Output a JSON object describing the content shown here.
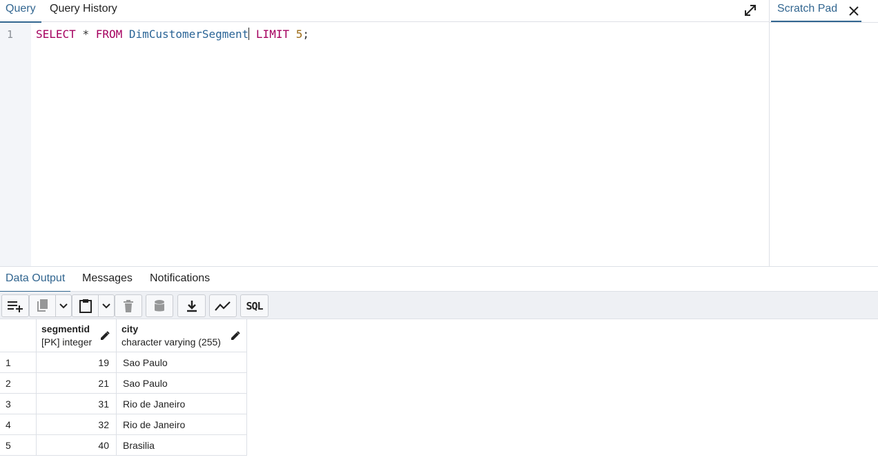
{
  "tabs": {
    "query": "Query",
    "query_history": "Query History"
  },
  "scratch_pad": {
    "title": "Scratch Pad"
  },
  "editor": {
    "line_number": "1",
    "tokens": {
      "select": "SELECT",
      "star": "*",
      "from": "FROM",
      "table": "DimCustomerSegment",
      "limit": "LIMIT",
      "limit_value": "5",
      "semicolon": ";"
    }
  },
  "output_tabs": {
    "data_output": "Data Output",
    "messages": "Messages",
    "notifications": "Notifications"
  },
  "toolbar": {
    "sql_label": "SQL"
  },
  "grid": {
    "columns": [
      {
        "name": "segmentid",
        "type": "[PK] integer"
      },
      {
        "name": "city",
        "type": "character varying (255)"
      }
    ],
    "rows": [
      {
        "num": "1",
        "segmentid": "19",
        "city": "Sao Paulo"
      },
      {
        "num": "2",
        "segmentid": "21",
        "city": "Sao Paulo"
      },
      {
        "num": "3",
        "segmentid": "31",
        "city": "Rio de Janeiro"
      },
      {
        "num": "4",
        "segmentid": "32",
        "city": "Rio de Janeiro"
      },
      {
        "num": "5",
        "segmentid": "40",
        "city": "Brasilia"
      }
    ]
  },
  "colors": {
    "accent": "#326690",
    "keyword": "#a5005f",
    "identifier": "#2a6496",
    "number": "#9c6b16"
  }
}
